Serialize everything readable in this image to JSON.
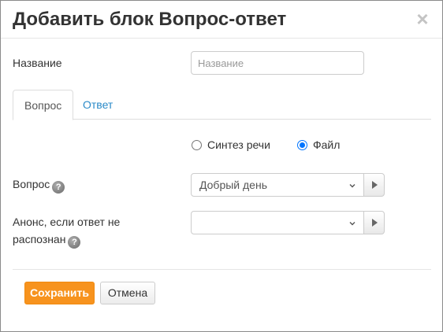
{
  "dialog": {
    "title": "Добавить блок Вопрос-ответ",
    "close_label": "×"
  },
  "form": {
    "name_label": "Название",
    "name_placeholder": "Название",
    "name_value": "",
    "tabs": [
      {
        "label": "Вопрос",
        "active": true
      },
      {
        "label": "Ответ",
        "active": false
      }
    ],
    "source_options": [
      {
        "label": "Синтез речи",
        "checked": false
      },
      {
        "label": "Файл",
        "checked": true
      }
    ],
    "question_label": "Вопрос",
    "question_select_value": "Добрый день",
    "announce_label_line1": "Анонс, если ответ не",
    "announce_label_line2": "распознан",
    "announce_select_value": "",
    "help_icon_glyph": "?"
  },
  "footer": {
    "save_label": "Сохранить",
    "cancel_label": "Отмена"
  },
  "colors": {
    "primary_button": "#f7931e",
    "link_tab": "#2a8ac8",
    "radio_checked": "#0075ff"
  }
}
